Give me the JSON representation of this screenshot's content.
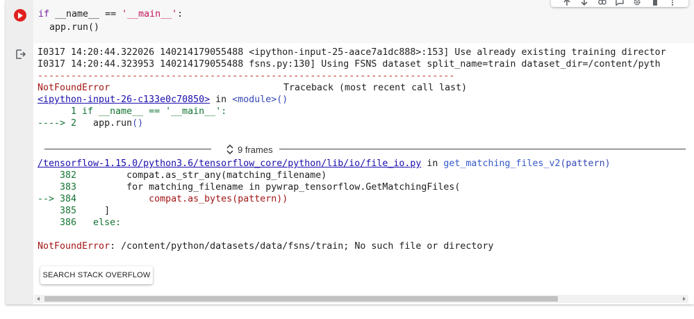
{
  "code_cell": {
    "lines": [
      {
        "kw": "if",
        "mid": " __name__ == ",
        "str": "'__main__'",
        "end": ":"
      },
      {
        "text": "  app.run()"
      }
    ]
  },
  "toolbar": {
    "icons": [
      "arrow-up-icon",
      "arrow-down-icon",
      "link-icon",
      "comment-icon",
      "gear-icon",
      "trash-icon",
      "more-vert-icon"
    ]
  },
  "output": {
    "log_lines": [
      "I0317 14:20:44.322026 140214179055488 <ipython-input-25-aace7a1dc888>:153] Use already existing training director",
      "I0317 14:20:44.323953 140214179055488 fsns.py:130] Using FSNS dataset split_name=train dataset_dir=/content/pyth"
    ],
    "divider": "---------------------------------------------------------------------------",
    "error_name": "NotFoundError",
    "traceback_header": "Traceback (most recent call last)",
    "frame1": {
      "link": "<ipython-input-26-c133e0c70850>",
      "in": " in ",
      "module": "<module>",
      "parens": "()",
      "line1_no": "      1 ",
      "line1_kw": "if",
      "line1_mid": " __name__ == ",
      "line1_str": "'__main__'",
      "line1_end": ":",
      "arrow": "----> 2 ",
      "line2_code": "  app.run",
      "line2_parens": "()"
    },
    "frames_label": "9 frames",
    "frame2": {
      "link": "/tensorflow-1.15.0/python3.6/tensorflow_core/python/lib/io/file_io.py",
      "in": " in ",
      "func": "get_matching_files_v2",
      "args": "(pattern)",
      "lines": [
        {
          "prefix": "    382 ",
          "code": "        compat.as_str_any(matching_filename)"
        },
        {
          "prefix": "    383 ",
          "code": "        for matching_filename in pywrap_tensorflow.GetMatchingFiles("
        },
        {
          "prefix": "--> 384 ",
          "code": "            compat.as_bytes(pattern))"
        },
        {
          "prefix": "    385 ",
          "code": "    ]"
        },
        {
          "prefix": "    386 ",
          "code": "  else:"
        }
      ]
    },
    "final_error_name": "NotFoundError",
    "final_error_msg": ": /content/python/datasets/data/fsns/train; No such file or directory"
  },
  "search_button": {
    "label": "SEARCH STACK OVERFLOW"
  }
}
